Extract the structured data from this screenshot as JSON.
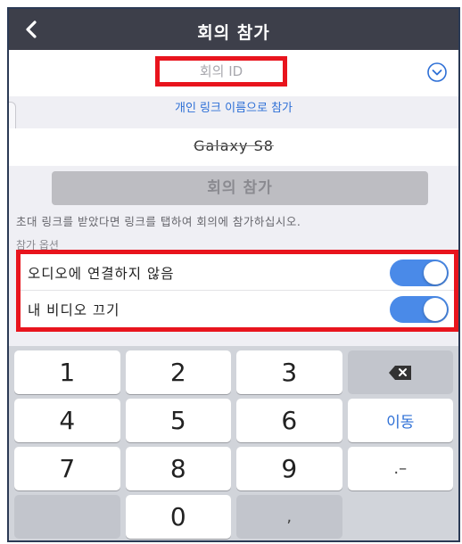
{
  "header": {
    "title": "회의 참가"
  },
  "meeting_id": {
    "placeholder": "회의 ID"
  },
  "personal_link_label": "개인 링크 이름으로 참가",
  "device_name": "Galaxy S8",
  "join_button_label": "회의 참가",
  "hint_text": "초대 링크를 받았다면 링크를 탭하여 회의에 참가하십시오.",
  "section_label": "참가 옵션",
  "options": [
    {
      "label": "오디오에 연결하지 않음",
      "enabled": true
    },
    {
      "label": "내 비디오 끄기",
      "enabled": true
    }
  ],
  "keypad": {
    "keys": [
      "1",
      "2",
      "3",
      "⌫",
      "4",
      "5",
      "6",
      "이동",
      "7",
      "8",
      "9",
      ".–",
      "",
      "0",
      ","
    ]
  },
  "colors": {
    "topbar": "#3d3f4a",
    "highlight": "#e8141d",
    "accent": "#2d6fd6",
    "toggle_on": "#4a8ae8"
  }
}
